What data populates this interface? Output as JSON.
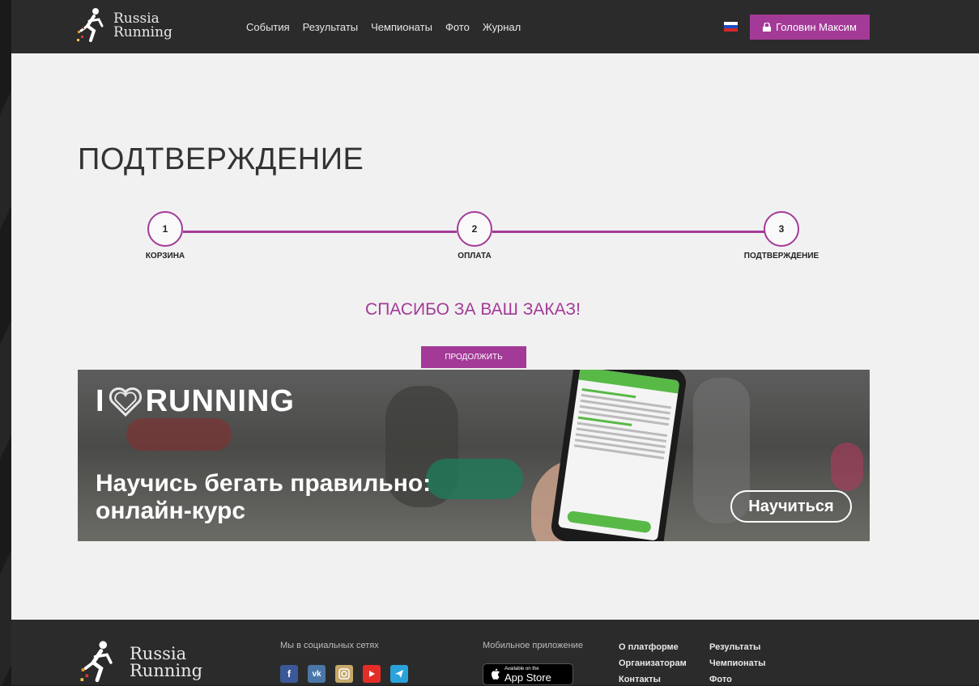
{
  "header": {
    "logo_line1": "Russia",
    "logo_line2": "Running",
    "nav": [
      "События",
      "Результаты",
      "Чемпионаты",
      "Фото",
      "Журнал"
    ],
    "language_flag": "ru-flag-icon",
    "user_button_label": "Головин Максим",
    "user_button_icon": "lock-icon",
    "accent_color": "#a33a97"
  },
  "main": {
    "title": "ПОДТВЕРЖДЕНИЕ",
    "steps": [
      {
        "number": "1",
        "label": "КОРЗИНА"
      },
      {
        "number": "2",
        "label": "ОПЛАТА"
      },
      {
        "number": "3",
        "label": "ПОДТВЕРЖДЕНИЕ"
      }
    ],
    "thanks_text": "СПАСИБО ЗА ВАШ ЗАКАЗ!",
    "continue_label": "ПРОДОЛЖИТЬ"
  },
  "banner": {
    "brand_left": "I",
    "brand_right": "RUNNING",
    "promo_line1": "Научись бегать правильно:",
    "promo_line2": "онлайн-курс",
    "cta_label": "Научиться"
  },
  "footer": {
    "logo_line1": "Russia",
    "logo_line2": "Running",
    "social_title": "Мы в социальных сетях",
    "socials": [
      "facebook-icon",
      "vk-icon",
      "instagram-icon",
      "youtube-icon",
      "telegram-icon"
    ],
    "app_title": "Мобильное приложение",
    "appstore_small": "Available on the",
    "appstore_big": "App Store",
    "links_col1": [
      "О платформе",
      "Организаторам",
      "Контакты"
    ],
    "links_col2": [
      "Результаты",
      "Чемпионаты",
      "Фото"
    ]
  }
}
